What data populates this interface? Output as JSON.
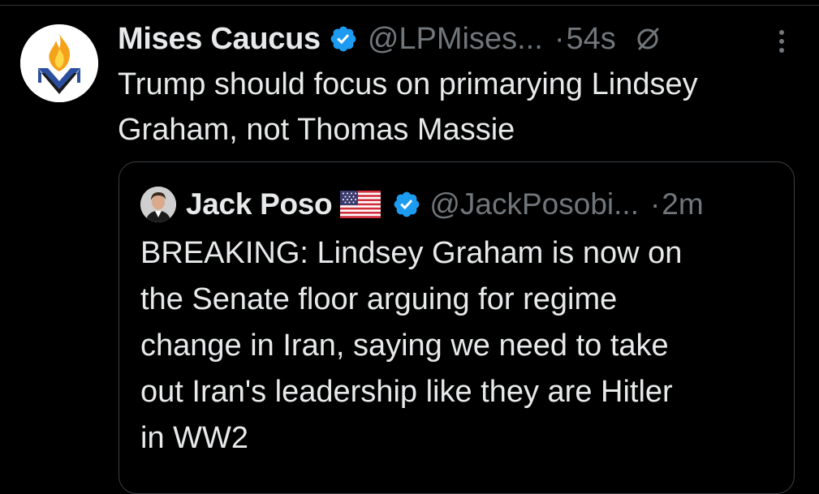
{
  "colors": {
    "background": "#000000",
    "text_primary": "#e7e9ea",
    "text_secondary": "#71767b",
    "verified_blue": "#1d9bf0",
    "border": "#3b3f43"
  },
  "tweet": {
    "author": {
      "display_name": "Mises Caucus",
      "handle": "@LPMises...",
      "avatar_icon": "mises-caucus-logo",
      "verified_icon": "verified-badge-icon"
    },
    "separator": "·",
    "timestamp": "54s",
    "edited_icon": "edited-slash-icon",
    "more_icon": "more-dots-icon",
    "text_lines": [
      "Trump should focus on primarying Lindsey",
      "Graham, not Thomas Massie"
    ]
  },
  "quoted_tweet": {
    "author": {
      "display_name": "Jack Poso",
      "flag_icon": "us-flag-icon",
      "verified_icon": "verified-badge-icon",
      "handle": "@JackPosobi..."
    },
    "separator": "·",
    "timestamp": "2m",
    "text_lines": [
      "BREAKING: Lindsey Graham is now on",
      "the Senate floor arguing for regime",
      "change in Iran, saying we need to take",
      "out Iran's leadership like they are Hitler",
      "in WW2"
    ]
  }
}
